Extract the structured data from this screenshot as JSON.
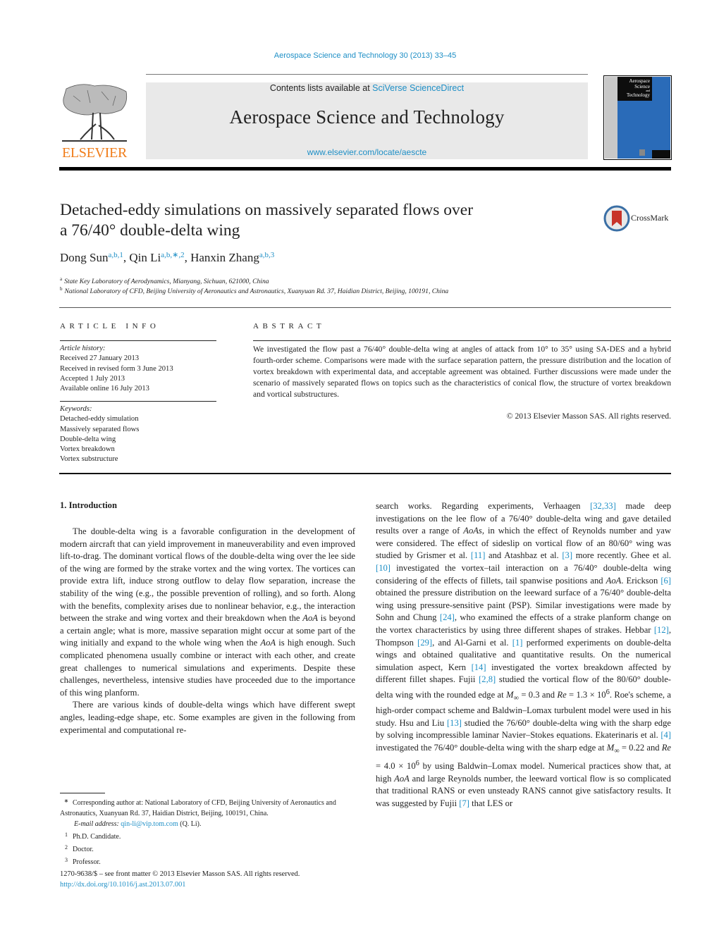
{
  "header": {
    "journal_ref": "Aerospace Science and Technology 30 (2013) 33–45",
    "contents_prefix": "Contents lists available at ",
    "contents_link": "SciVerse ScienceDirect",
    "journal_title": "Aerospace Science and Technology",
    "journal_url": "www.elsevier.com/locate/aescte",
    "publisher_wordmark": "ELSEVIER",
    "cover_text": [
      "Aerospace",
      "Science",
      "and",
      "Technology"
    ],
    "brand_colors": {
      "link": "#1e8fc6",
      "elsevier_orange": "#f07d1a",
      "cover_blue": "#2a6bb8"
    }
  },
  "article": {
    "title_line1": "Detached-eddy simulations on massively separated flows over",
    "title_line2": "a 76/40° double-delta wing",
    "crossmark_label": "CrossMark",
    "authors": [
      {
        "name": "Dong Sun",
        "marks": "a,b,1",
        "sep": ", "
      },
      {
        "name": "Qin Li",
        "marks": "a,b,∗,2",
        "sep": ", "
      },
      {
        "name": "Hanxin Zhang",
        "marks": "a,b,3",
        "sep": ""
      }
    ],
    "affiliations": [
      {
        "mark": "a",
        "text": "State Key Laboratory of Aerodynamics, Mianyang, Sichuan, 621000, China"
      },
      {
        "mark": "b",
        "text": "National Laboratory of CFD, Beijing University of Aeronautics and Astronautics, Xuanyuan Rd. 37, Haidian District, Beijing, 100191, China"
      }
    ]
  },
  "article_info": {
    "heading": "ARTICLE INFO",
    "history_label": "Article history:",
    "history": [
      "Received 27 January 2013",
      "Received in revised form 3 June 2013",
      "Accepted 1 July 2013",
      "Available online 16 July 2013"
    ],
    "keywords_label": "Keywords:",
    "keywords": [
      "Detached-eddy simulation",
      "Massively separated flows",
      "Double-delta wing",
      "Vortex breakdown",
      "Vortex substructure"
    ]
  },
  "abstract": {
    "heading": "ABSTRACT",
    "text": "We investigated the flow past a 76/40° double-delta wing at angles of attack from 10° to 35° using SA-DES and a hybrid fourth-order scheme. Comparisons were made with the surface separation pattern, the pressure distribution and the location of vortex breakdown with experimental data, and acceptable agreement was obtained. Further discussions were made under the scenario of massively separated flows on topics such as the characteristics of conical flow, the structure of vortex breakdown and vortical substructures.",
    "copyright": "© 2013 Elsevier Masson SAS. All rights reserved."
  },
  "body": {
    "section_heading": "1.  Introduction",
    "col1_p1": [
      "The double-delta wing is a favorable configuration in the development of modern aircraft that can yield improvement in maneuverability and even improved lift-to-drag. The dominant vortical flows of the double-delta wing over the lee side of the wing are formed by the strake vortex and the wing vortex. The vortices can provide extra lift, induce strong outflow to delay flow separation, increase the stability of the wing (e.g., the possible prevention of rolling), and so forth. Along with the benefits, complexity arises due to nonlinear behavior, e.g., the interaction between the strake and wing vortex and their breakdown when the ",
      "AoA",
      " is beyond a certain angle; what is more, massive separation might occur at some part of the wing initially and expand to the whole wing when the ",
      "AoA",
      " is high enough. Such complicated phenomena usually combine or interact with each other, and create great challenges to numerical simulations and experiments. Despite these challenges, nevertheless, intensive studies have proceeded due to the importance of this wing planform."
    ],
    "col1_p2": "There are various kinds of double-delta wings which have different swept angles, leading-edge shape, etc. Some examples are given in the following from experimental and computational re-",
    "col2": {
      "s1": "search works. Regarding experiments, Verhaagen ",
      "r1": "[32,33]",
      "s2": " made deep investigations on the lee flow of a 76/40° double-delta wing and gave detailed results over a range of ",
      "aoas": "AoAs",
      "s3": ", in which the effect of Reynolds number and yaw were considered. The effect of sideslip on vortical flow of an 80/60° wing was studied by Grismer et al. ",
      "r2": "[11]",
      "s4": " and Atashbaz et al. ",
      "r3": "[3]",
      "s5": " more recently. Ghee et al. ",
      "r4": "[10]",
      "s6": " investigated the vortex–tail interaction on a 76/40° double-delta wing considering of the effects of fillets, tail spanwise positions and ",
      "aoa1": "AoA",
      "s7": ". Erickson ",
      "r5": "[6]",
      "s8": " obtained the pressure distribution on the leeward surface of a 76/40° double-delta wing using pressure-sensitive paint (PSP). Similar investigations were made by Sohn and Chung ",
      "r6": "[24]",
      "s9": ", who examined the effects of a strake planform change on the vortex characteristics by using three different shapes of strakes. Hebbar ",
      "r7": "[12]",
      "s10": ", Thompson ",
      "r8": "[29]",
      "s11": ", and Al-Garni et al. ",
      "r9": "[1]",
      "s12": " performed experiments on double-delta wings and obtained qualitative and quantitative results. On the numerical simulation aspect, Kern ",
      "r10": "[14]",
      "s13": " investigated the vortex breakdown affected by different fillet shapes. Fujii ",
      "r11": "[2,8]",
      "s14": " studied the vortical flow of the 80/60° double-delta wing with the rounded edge at ",
      "m1": "M",
      "m1sub": "∞",
      "s15": " = 0.3 and ",
      "re1": "Re",
      "s16": " = 1.3 × 10",
      "e1": "6",
      "s17": ". Roe's scheme, a high-order compact scheme and Baldwin–Lomax turbulent model were used in his study. Hsu and Liu ",
      "r12": "[13]",
      "s18": " studied the 76/60° double-delta wing with the sharp edge by solving incompressible laminar Navier–Stokes equations. Ekaterinaris et al. ",
      "r13": "[4]",
      "s19": " investigated the 76/40° double-delta wing with the sharp edge at ",
      "m2": "M",
      "m2sub": "∞",
      "s20": " = 0.22 and ",
      "re2": "Re",
      "s21": " = 4.0 × 10",
      "e2": "6",
      "s22": " by using Baldwin–Lomax model. Numerical practices show that, at high ",
      "aoa2": "AoA",
      "s23": " and large Reynolds number, the leeward vortical flow is so complicated that traditional RANS or even unsteady RANS cannot give satisfactory results. It was suggested by Fujii ",
      "r14": "[7]",
      "s24": " that LES or"
    }
  },
  "footnotes": {
    "corresponding_mark": "∗",
    "corresponding": "Corresponding author at: National Laboratory of CFD, Beijing University of Aeronautics and Astronautics, Xuanyuan Rd. 37, Haidian District, Beijing, 100191, China.",
    "email_label": "E-mail address: ",
    "email": "qin-li@vip.tom.com",
    "email_suffix": " (Q. Li).",
    "notes": [
      {
        "mark": "1",
        "text": "Ph.D. Candidate."
      },
      {
        "mark": "2",
        "text": "Doctor."
      },
      {
        "mark": "3",
        "text": "Professor."
      }
    ]
  },
  "front_matter": {
    "issn_line": "1270-9638/$ – see front matter  © 2013 Elsevier Masson SAS. All rights reserved.",
    "doi": "http://dx.doi.org/10.1016/j.ast.2013.07.001"
  }
}
